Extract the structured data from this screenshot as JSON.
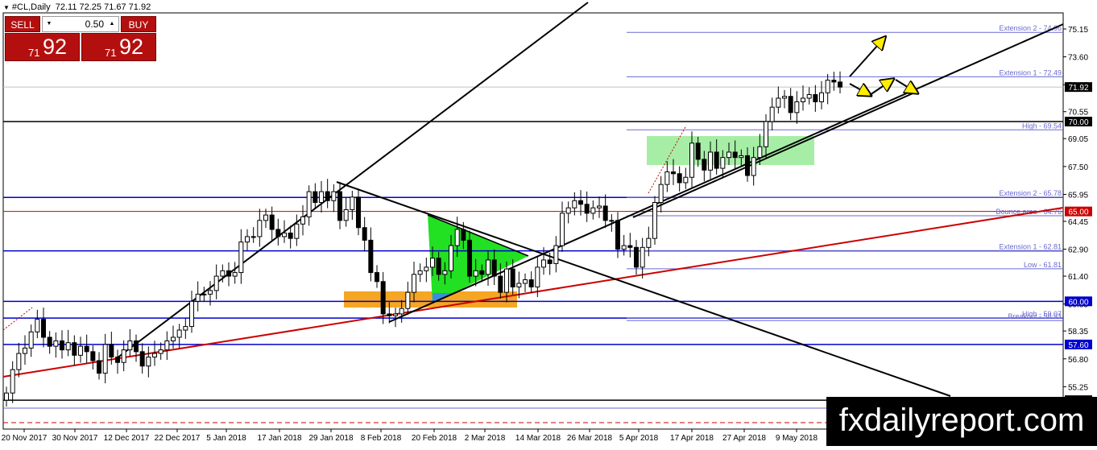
{
  "header": {
    "symbol": "#CL,Daily",
    "ohlc": "72.11 72.25 71.67 71.92"
  },
  "trade_panel": {
    "sell_label": "SELL",
    "buy_label": "BUY",
    "lot_value": "0.50",
    "sell_price_small": "71",
    "sell_price_big": "92",
    "buy_price_small": "71",
    "buy_price_big": "92"
  },
  "watermark": "fxdailyreport.com",
  "colors": {
    "sell_red": "#b40f0f",
    "level_blue": "#0000cc",
    "fib_violet": "#6a6ad0",
    "support_red": "#cc0000",
    "triangle_green": "#22e022",
    "box_green": "#a6eea6",
    "box_orange": "#f5a623",
    "arrow_yellow": "#ffee00"
  },
  "chart_data": {
    "type": "candlestick",
    "symbol": "#CL",
    "timeframe": "Daily",
    "ylim": [
      53.0,
      76.5
    ],
    "y_ticks": [
      75.15,
      73.6,
      72.05,
      70.55,
      69.05,
      67.5,
      65.95,
      64.45,
      62.9,
      61.4,
      59.85,
      58.35,
      56.8,
      55.25,
      53.7
    ],
    "y_tick_labels": [
      "75.15",
      "73.60",
      "72.05",
      "70.55",
      "69.05",
      "67.50",
      "65.95",
      "64.45",
      "62.90",
      "61.40",
      "59.85",
      "58.35",
      "56.80",
      "55.25",
      "53.70"
    ],
    "x_tick_labels": [
      "20 Nov 2017",
      "30 Nov 2017",
      "12 Dec 2017",
      "22 Dec 2017",
      "5 Jan 2018",
      "17 Jan 2018",
      "29 Jan 2018",
      "8 Feb 2018",
      "20 Feb 2018",
      "2 Mar 2018",
      "14 Mar 2018",
      "26 Mar 2018",
      "5 Apr 2018",
      "17 Apr 2018",
      "27 Apr 2018",
      "9 May 2018"
    ],
    "candle_close": [
      54.9,
      56.2,
      57.1,
      57.4,
      58.3,
      59.0,
      58.0,
      57.5,
      57.8,
      57.3,
      57.7,
      57.0,
      57.5,
      57.2,
      56.7,
      56.0,
      57.6,
      56.9,
      56.6,
      57.3,
      57.8,
      57.2,
      56.4,
      56.9,
      57.1,
      57.3,
      57.8,
      58.0,
      58.4,
      58.6,
      60.0,
      60.4,
      60.4,
      60.6,
      61.4,
      61.7,
      61.4,
      61.6,
      63.3,
      63.6,
      63.6,
      64.5,
      64.8,
      64.0,
      63.6,
      63.8,
      63.5,
      64.3,
      64.7,
      66.1,
      65.5,
      66.1,
      65.6,
      66.1,
      64.5,
      65.1,
      65.8,
      64.1,
      63.4,
      61.6,
      61.1,
      59.3,
      59.2,
      59.3,
      59.6,
      60.5,
      61.5,
      61.7,
      61.9,
      62.4,
      61.5,
      61.7,
      63.1,
      64.0,
      63.4,
      61.4,
      61.7,
      61.5,
      62.3,
      61.4,
      60.5,
      61.8,
      60.8,
      61.0,
      61.2,
      60.8,
      61.9,
      62.3,
      62.1,
      63.1,
      64.9,
      65.2,
      65.6,
      65.4,
      64.9,
      65.2,
      65.3,
      64.5,
      64.5,
      62.9,
      63.1,
      63.0,
      61.9,
      63.0,
      63.5,
      65.5,
      66.5,
      67.2,
      67.1,
      66.6,
      66.9,
      68.8,
      67.9,
      67.3,
      68.3,
      67.4,
      68.0,
      68.3,
      68.0,
      68.1,
      67.0,
      68.0,
      68.6,
      70.0,
      70.8,
      71.3,
      71.4,
      70.5,
      71.1,
      71.3,
      71.5,
      71.1,
      71.6,
      72.3,
      72.2,
      71.92
    ],
    "horizontal_levels": [
      {
        "value": 70.0,
        "label": "70.00",
        "color": "#000000"
      },
      {
        "value": 65.0,
        "label": "65.00",
        "color": "#cc0000"
      },
      {
        "value": 60.0,
        "label": "60.00",
        "color": "#0000cc"
      },
      {
        "value": 57.6,
        "label": "57.60",
        "color": "#0000cc"
      },
      {
        "value": 54.5,
        "label": "54.50",
        "color": "#000000"
      },
      {
        "value": 71.92,
        "label": "71.92",
        "color": "#000000"
      }
    ],
    "fib_levels": [
      {
        "value": 74.96,
        "label": "Extension 2 - 74.96"
      },
      {
        "value": 72.49,
        "label": "Extension 1 - 72.49"
      },
      {
        "value": 69.54,
        "label": "High - 69.54"
      },
      {
        "value": 65.78,
        "label": "Extension 2 - 65.78"
      },
      {
        "value": 64.76,
        "label": "Bounce area - 64.76"
      },
      {
        "value": 62.81,
        "label": "Extension 1 - 62.81"
      },
      {
        "value": 61.81,
        "label": "Low - 61.81"
      },
      {
        "value": 59.07,
        "label": "High - 59.07"
      },
      {
        "value": 58.93,
        "label": "Breakout - 58.93"
      },
      {
        "value": 54.06,
        "label": "Trap Area - 54.06"
      }
    ],
    "grid": false
  }
}
